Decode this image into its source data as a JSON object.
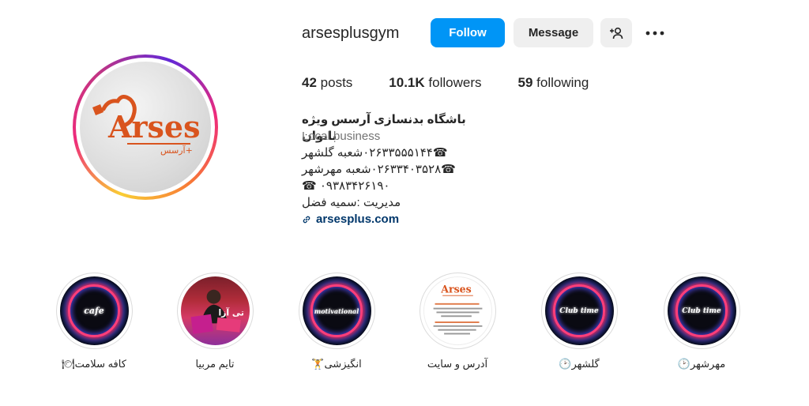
{
  "profile": {
    "username": "arsesplusgym",
    "follow_label": "Follow",
    "message_label": "Message",
    "avatar_logo_text": "Arses",
    "avatar_logo_sub": "آرسس+"
  },
  "stats": {
    "posts_count": "42",
    "posts_label": "posts",
    "followers_count": "10.1K",
    "followers_label": "followers",
    "following_count": "59",
    "following_label": "following"
  },
  "bio": {
    "name": "باشگاه بدنسازی آرسس ویژه بانوان",
    "category": "Local business",
    "line1": "☎۰۲۶۳۳۵۵۵۱۴۴شعبه گلشهر",
    "line2": "☎۰۲۶۳۳۴۰۳۵۲۸شعبه مهرشهر",
    "line3": "☎ ۰۹۳۸۳۴۲۶۱۹۰",
    "line4": "مدیریت :سمیه فضل",
    "link": "arsesplus.com"
  },
  "highlights": [
    {
      "label": "کافه سلامت🍽",
      "cover_text": "cafe",
      "style": "neon"
    },
    {
      "label": "تایم مربیا",
      "cover_text": "تی آزا",
      "style": "photo"
    },
    {
      "label": "انگیزشی🏋",
      "cover_text": "motivational",
      "style": "neon"
    },
    {
      "label": "آدرس و سایت",
      "cover_text": "Arses",
      "style": "card"
    },
    {
      "label": "گلشهر🕑",
      "cover_text": "Club time",
      "style": "neon"
    },
    {
      "label": "مهرشهر🕑",
      "cover_text": "Club time",
      "style": "neon"
    }
  ],
  "colors": {
    "follow_button": "#0095f6",
    "secondary_button": "#efefef",
    "link": "#00376b",
    "muted": "#737373",
    "brand_orange": "#d9541e"
  }
}
